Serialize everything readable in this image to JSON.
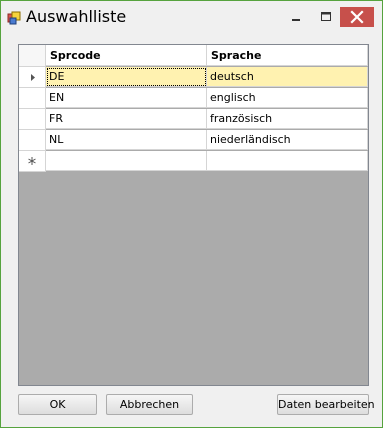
{
  "window": {
    "title": "Auswahlliste",
    "icons": {
      "app": "form-icon",
      "minimize": "minimize-icon",
      "maximize": "maximize-icon",
      "close": "close-icon"
    },
    "colors": {
      "frame": "#56a33e",
      "close": "#c7504b",
      "selection": "#fff2b0"
    }
  },
  "grid": {
    "columns": [
      "Sprcode",
      "Sprache"
    ],
    "rows": [
      [
        "DE",
        "deutsch"
      ],
      [
        "EN",
        "englisch"
      ],
      [
        "FR",
        "französisch"
      ],
      [
        "NL",
        "niederländisch"
      ]
    ],
    "selected_row": 0,
    "new_row_marker": "*",
    "current_row_marker": "▸"
  },
  "buttons": {
    "ok": "OK",
    "cancel": "Abbrechen",
    "edit": "Daten bearbeiten"
  }
}
